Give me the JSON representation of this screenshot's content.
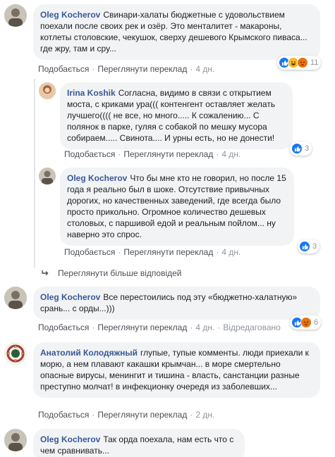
{
  "comments": [
    {
      "author": "Oleg Kocherov",
      "text": "Свинари-халаты бюджетные с удовольствием поехали после своих рек и озёр. Это менталитет - макароны, котлеты столовские, чекушок, сверху дешевого Крымского пиваса... где жру, там и сру...",
      "like": "Подобається",
      "translate": "Переглянути переклад",
      "time": "4 дн.",
      "reactions_count": "11"
    },
    {
      "author": "Irina Koshik",
      "text": "Согласна, видимо в связи с открытием моста, с криками ура((( контенгент оставляет желать лучшего(((( не все, но много..... К сожалению... С полянок в парке, гуляя с собакой по мешку мусора собираем..... Свинота.... И урны есть, но не донести!",
      "like": "Подобається",
      "translate": "Переглянути переклад",
      "time": "4 дн.",
      "reactions_count": "3"
    },
    {
      "author": "Oleg Kocherov",
      "text": "Что бы мне кто не говорил, но после 15 года я реально был в шоке. Отсутствие привычных дорогих, но качественных заведений, где всегда было просто прикольно. Огромное количество дешевых столовых, с паршивой едой и реальным пойлом... ну наверно это спрос.",
      "like": "Подобається",
      "translate": "Переглянути переклад",
      "time": "4 дн.",
      "reactions_count": "3"
    },
    {
      "author": "Oleg Kocherov",
      "text": "Все перестоились под эту «бюджетно-халатную» срань... с орды...)))",
      "like": "Подобається",
      "translate": "Переглянути переклад",
      "time": "4 дн.",
      "edited": "Відредаговано",
      "reactions_count": "6"
    },
    {
      "author": "Анатолий Колодяжный",
      "text": "глупые, тупые комменты. люди приехали к морю, а нем плавают какашки крымчан... в море смертельно опасные вирусы, менингит и тишина - власть, санстанции разные преступно молчат! в инфекционку очередя из заболевших...",
      "like": "Подобається",
      "translate": "Переглянути переклад",
      "time": "2 дн."
    },
    {
      "author": "Oleg Kocherov",
      "text": "Так орда поехала, нам есть что с чем сравнивать..."
    }
  ],
  "view_more_replies": "Переглянути більше відповідей",
  "colors": {
    "like": "#1877f2",
    "haha": "#f7b928",
    "angry": "#e9710f",
    "link": "#385898"
  }
}
